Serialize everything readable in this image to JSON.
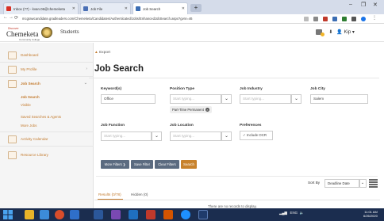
{
  "browser": {
    "tabs": [
      {
        "title": "Inbox (77) - kvan.06@chemeketa",
        "favicon_color": "#d93025",
        "active": false
      },
      {
        "title": "Job File",
        "favicon_color": "#4a6fb5",
        "active": false
      },
      {
        "title": "Job Search",
        "favicon_color": "#3b6db3",
        "active": true
      }
    ],
    "new_tab_label": "+",
    "url": "mcgrawcandidate.gradleaders.com/Chemeketa/Candidates/Authenticated/Jobs/EnhancedJobSearch.aspx?gvnr=46",
    "window_controls": [
      "–",
      "❐",
      "✕"
    ]
  },
  "site": {
    "logo_sub": "Discover",
    "logo_main": "Chemeketa",
    "logo_tag": "Community College",
    "section": "Students",
    "user_name": "Kip"
  },
  "sidebar": {
    "items": [
      {
        "label": "Dashboard"
      },
      {
        "label": "My Profile"
      },
      {
        "label": "Job Search"
      }
    ],
    "sub_items": [
      {
        "label": "Job Search",
        "selected": true
      },
      {
        "label": "Visible",
        "selected": false
      },
      {
        "label": "Saved Searches & Agents",
        "selected": false
      },
      {
        "label": "More Jobs",
        "selected": false
      }
    ],
    "bottom_items": [
      {
        "label": "Activity Calendar"
      },
      {
        "label": "Resource Library"
      }
    ]
  },
  "main": {
    "export_label": "Export",
    "title": "Job Search",
    "keywords": {
      "label": "Keyword(s)",
      "value": "Office"
    },
    "position_type": {
      "label": "Position Type",
      "placeholder": "Start typing...",
      "chip": "Part-Time Permanent"
    },
    "job_industry": {
      "label": "Job Industry",
      "placeholder": "Start typing..."
    },
    "job_city": {
      "label": "Job City",
      "value": "Salem"
    },
    "job_function": {
      "label": "Job Function",
      "placeholder": "Start typing..."
    },
    "job_location": {
      "label": "Job Location",
      "placeholder": "Start typing..."
    },
    "preferences": {
      "label": "Preferences",
      "checkbox_label": "Include OCR",
      "checked": true
    },
    "buttons": {
      "more_filters": "More Filters ❯",
      "save_filter": "Save Filter",
      "clear_filters": "Clear Filters",
      "search": "Search"
    },
    "sort": {
      "label": "Sort By",
      "value": "Deadline Date"
    },
    "result_tabs": [
      {
        "label": "Results (0/78)",
        "active": true
      },
      {
        "label": "Hidden (0)",
        "active": false
      }
    ],
    "no_records": "There are no records to display."
  },
  "taskbar": {
    "tray_text": "ENG",
    "time": "11:01 AM",
    "date": "6/26/2020"
  },
  "colors": {
    "accent": "#c8822c",
    "taskbar": "#1b2d4f",
    "button_dark": "#5b6b80"
  }
}
